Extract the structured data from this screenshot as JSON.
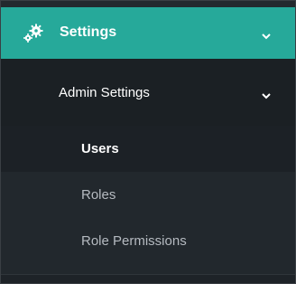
{
  "nav": {
    "settings": {
      "label": "Settings",
      "icon": "gears-icon",
      "expanded": true
    },
    "admin": {
      "label": "Admin Settings",
      "expanded": true
    },
    "items": [
      {
        "label": "Users",
        "active": true
      },
      {
        "label": "Roles",
        "active": false
      },
      {
        "label": "Role Permissions",
        "active": false
      }
    ]
  },
  "colors": {
    "accent": "#26a99a",
    "background": "#1c2126",
    "submenu_background": "#22282d",
    "text": "#ffffff",
    "muted_text": "#b5bac0"
  }
}
